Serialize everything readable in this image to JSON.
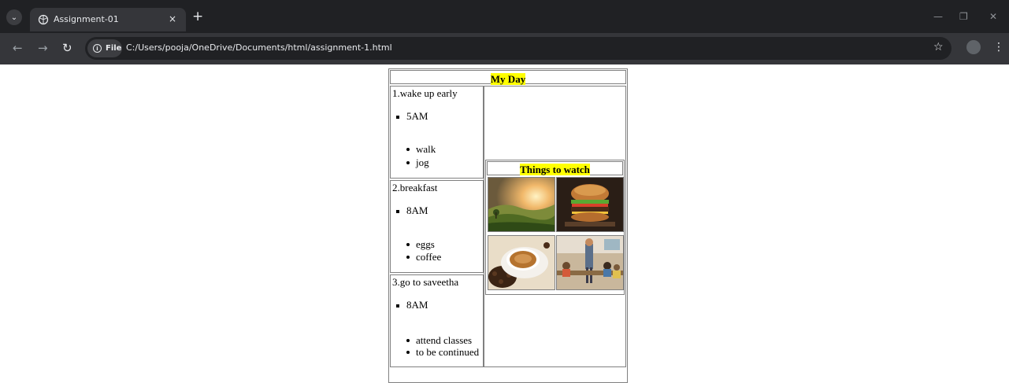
{
  "browser": {
    "tab_title": "Assignment-01",
    "tab_close": "×",
    "new_tab": "+",
    "file_label": "File",
    "url": "C:/Users/pooja/OneDrive/Documents/html/assignment-1.html"
  },
  "page": {
    "title": "My Day",
    "things_title": "Things to watch",
    "sections": [
      {
        "heading": "1.wake up early",
        "time": "5AM",
        "items": [
          "walk",
          "jog"
        ]
      },
      {
        "heading": "2.breakfast",
        "time": "8AM",
        "items": [
          "eggs",
          "coffee"
        ]
      },
      {
        "heading": "3.go to saveetha",
        "time": "8AM",
        "items": [
          "attend classes",
          "to be continued"
        ]
      }
    ]
  }
}
